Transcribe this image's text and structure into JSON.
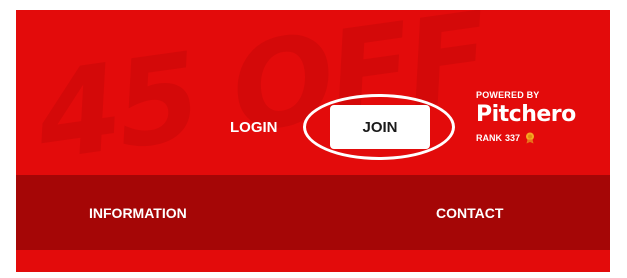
{
  "header": {
    "login_label": "LOGIN",
    "join_label": "JOIN",
    "powered_by": "POWERED BY",
    "brand": "Pitchero",
    "rank_label": "RANK",
    "rank_value": "337"
  },
  "nav": {
    "items": [
      {
        "label": "INFORMATION"
      },
      {
        "label": "CONTACT"
      }
    ]
  },
  "icons": {
    "pitchero_mark": "pitchero-o-icon",
    "rank_medal": "medal-icon"
  },
  "colors": {
    "primary_red": "#e30b0b",
    "nav_red": "#a50606",
    "medal": "#f5a623"
  }
}
